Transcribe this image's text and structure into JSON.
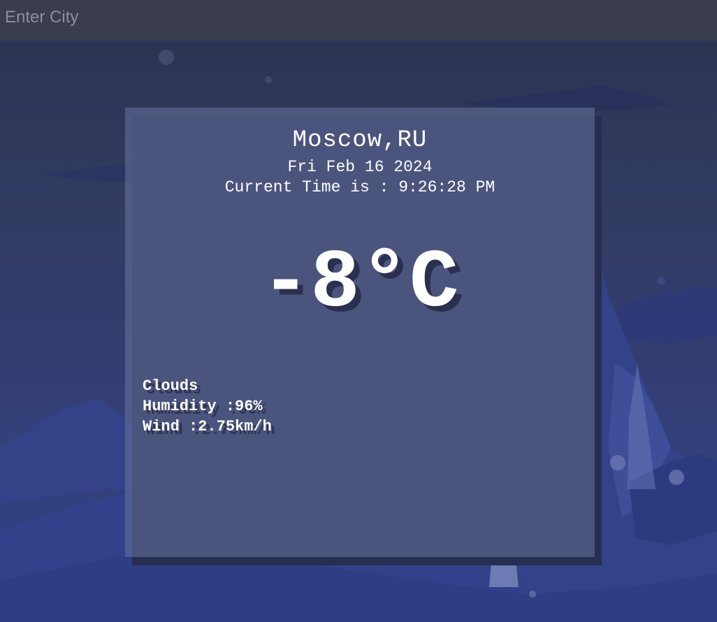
{
  "search": {
    "placeholder": "Enter City",
    "value": ""
  },
  "weather": {
    "city": "Moscow,RU",
    "date": "Fri Feb 16 2024",
    "time_prefix": "Current Time is : ",
    "time": "9:26:28 PM",
    "temperature": "-8°C",
    "condition": "Clouds",
    "humidity": "Humidity :96%",
    "wind": "Wind :2.75km/h"
  },
  "colors": {
    "accent_shadow": "#262e52",
    "text": "#ffffff",
    "search_bar": "#3c3e4e"
  }
}
